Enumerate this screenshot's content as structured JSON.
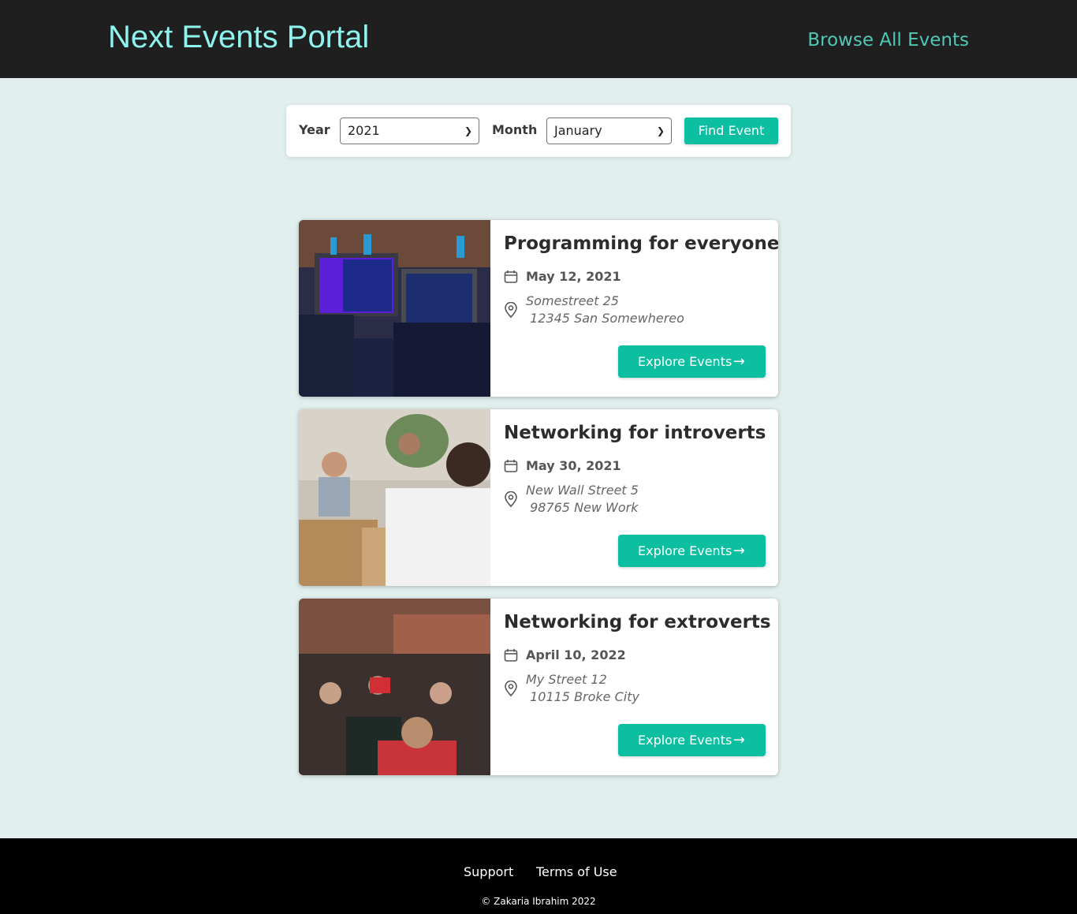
{
  "header": {
    "logo": "Next Events Portal",
    "nav_link": "Browse All Events"
  },
  "search": {
    "year_label": "Year",
    "year_value": "2021",
    "month_label": "Month",
    "month_value": "January",
    "button": "Find Event"
  },
  "events": [
    {
      "title": "Programming for everyone",
      "date": "May 12, 2021",
      "address": "Somestreet 25\n 12345 San Somewhereo",
      "button": "Explore Events"
    },
    {
      "title": "Networking for introverts",
      "date": "May 30, 2021",
      "address": "New Wall Street 5\n 98765 New Work",
      "button": "Explore Events"
    },
    {
      "title": "Networking for extroverts",
      "date": "April 10, 2022",
      "address": "My Street 12\n 10115 Broke City",
      "button": "Explore Events"
    }
  ],
  "footer": {
    "support": "Support",
    "terms": "Terms of Use",
    "copyright": "© Zakaria Ibrahim 2022"
  },
  "colors": {
    "accent": "#0cbfa0",
    "logo": "#8ff4ee",
    "header_bg": "#1f1f1f",
    "page_bg": "#e1efee",
    "footer_bg": "#000000"
  }
}
